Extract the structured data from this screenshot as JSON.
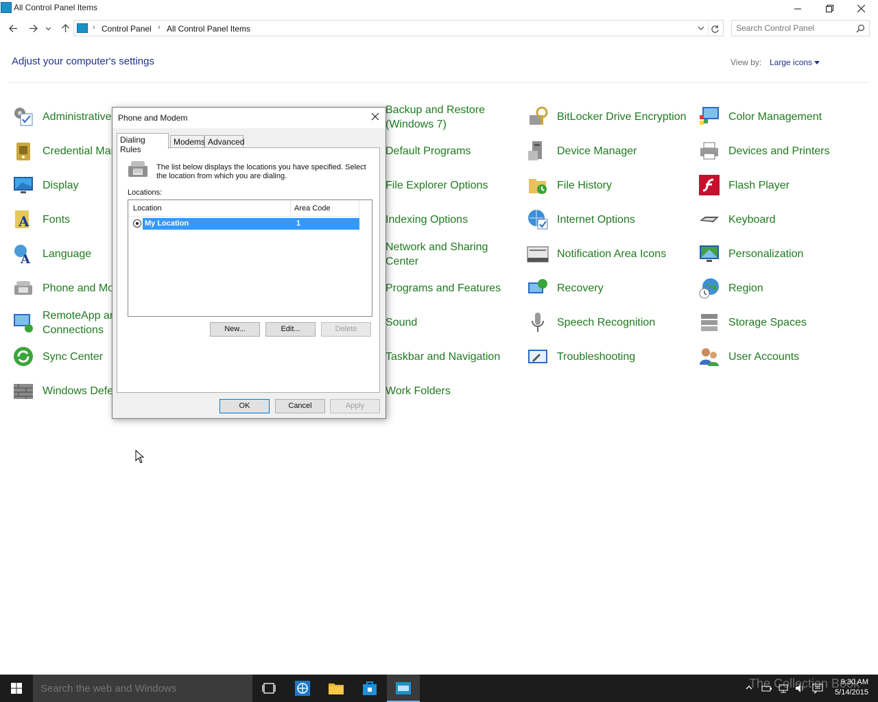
{
  "window": {
    "title": "All Control Panel Items"
  },
  "address": {
    "crumbs": [
      "Control Panel",
      "All Control Panel Items"
    ],
    "search_placeholder": "Search Control Panel"
  },
  "header": {
    "heading": "Adjust your computer's settings",
    "view_by_label": "View by:",
    "view_by_value": "Large icons"
  },
  "items": {
    "administrative": "Administrative",
    "credential": "Credential Mar",
    "display": "Display",
    "fonts": "Fonts",
    "language": "Language",
    "phone": "Phone and Mo",
    "remoteapp_1": "RemoteApp an",
    "remoteapp_2": "Connections",
    "sync": "Sync Center",
    "defender": "Windows Defe",
    "backup_1": "Backup and Restore",
    "backup_2": "(Windows 7)",
    "default_programs": "Default Programs",
    "file_explorer": "File Explorer Options",
    "indexing": "Indexing Options",
    "network_1": "Network and Sharing",
    "network_2": "Center",
    "programs": "Programs and Features",
    "sound": "Sound",
    "taskbar": "Taskbar and Navigation",
    "work_folders": "Work Folders",
    "bitlocker": "BitLocker Drive Encryption",
    "device_manager": "Device Manager",
    "file_history": "File History",
    "internet": "Internet Options",
    "notification": "Notification Area Icons",
    "recovery": "Recovery",
    "speech": "Speech Recognition",
    "troubleshooting": "Troubleshooting",
    "color": "Color Management",
    "devices_printers": "Devices and Printers",
    "flash": "Flash Player",
    "keyboard": "Keyboard",
    "personalization": "Personalization",
    "region": "Region",
    "storage": "Storage Spaces",
    "user_accounts": "User Accounts"
  },
  "dialog": {
    "title": "Phone and Modem",
    "tabs": [
      "Dialing Rules",
      "Modems",
      "Advanced"
    ],
    "intro": "The list below displays the locations you have specified. Select the location from which you are dialing.",
    "locations_label": "Locations:",
    "columns": [
      "Location",
      "Area Code"
    ],
    "rows": [
      {
        "location": "My Location",
        "area_code": "1"
      }
    ],
    "buttons": {
      "new": "New...",
      "edit": "Edit...",
      "delete": "Delete",
      "ok": "OK",
      "cancel": "Cancel",
      "apply": "Apply"
    }
  },
  "taskbar": {
    "search_placeholder": "Search the web and Windows",
    "time": "9:30 AM",
    "date": "5/14/2015",
    "watermark": "The Collection Book"
  },
  "colors": {
    "link_green": "#1f7a1f",
    "heading_blue": "#1e3287",
    "selection_blue": "#3399ff",
    "taskbar": "#1c1c1c"
  }
}
